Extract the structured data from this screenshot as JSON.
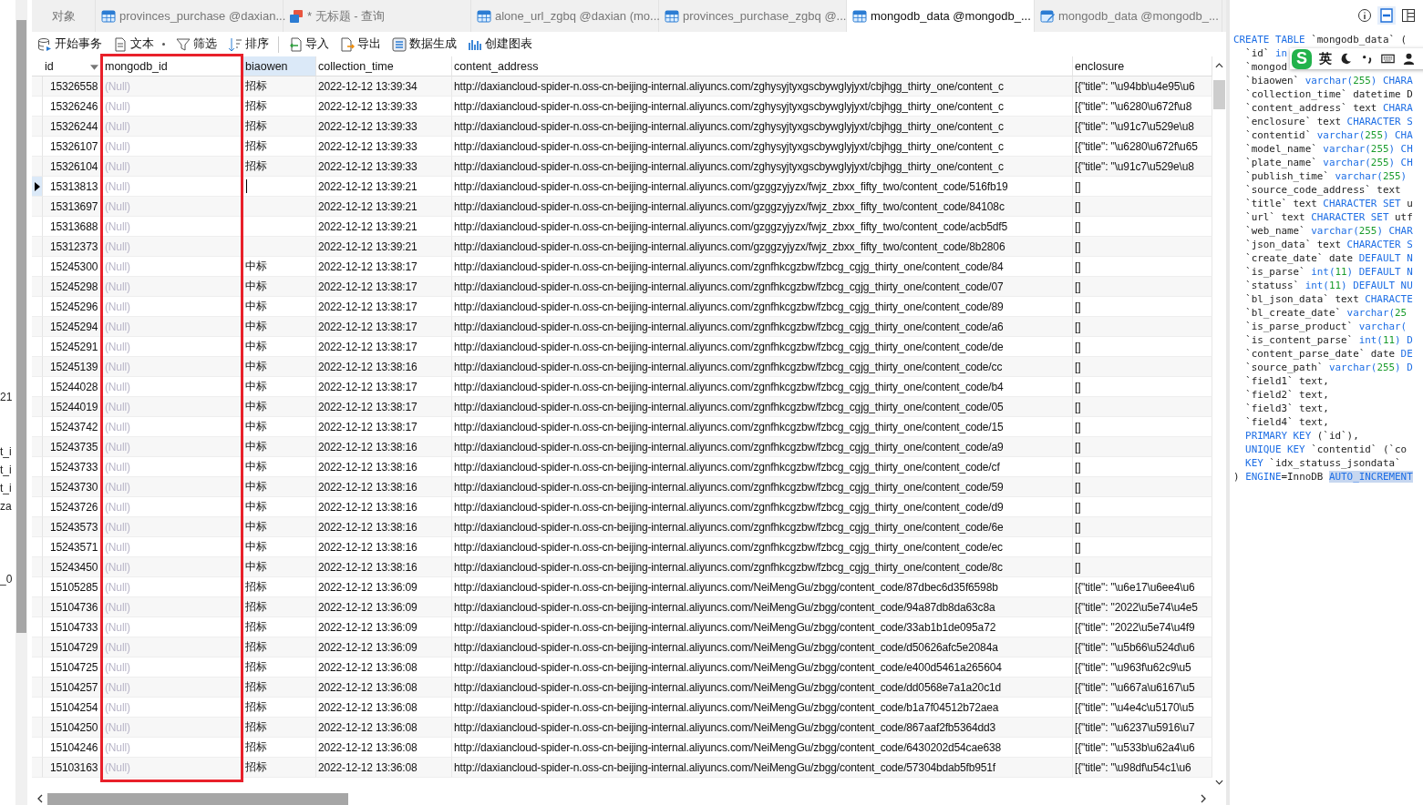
{
  "left_panel": {
    "fragments": [
      "21",
      "t_i",
      "t_i",
      "t_i",
      "za",
      "_0"
    ]
  },
  "tabs": [
    {
      "label": "对象",
      "kind": "plain",
      "selected": false
    },
    {
      "label": "provinces_purchase @daxian...",
      "kind": "table",
      "selected": false
    },
    {
      "label": "* 无标题 - 查询",
      "kind": "query",
      "selected": false
    },
    {
      "label": "alone_url_zgbq @daxian (mo...",
      "kind": "table",
      "selected": false
    },
    {
      "label": "provinces_purchase_zgbq @...",
      "kind": "table",
      "selected": false
    },
    {
      "label": "mongodb_data @mongodb_...",
      "kind": "table",
      "selected": true
    },
    {
      "label": "mongodb_data @mongodb_...",
      "kind": "design",
      "selected": false
    }
  ],
  "toolbar": [
    {
      "label": "开始事务",
      "kind": "transaction"
    },
    {
      "label": "文本",
      "kind": "text"
    },
    {
      "label": "筛选",
      "kind": "filter"
    },
    {
      "label": "排序",
      "kind": "sort"
    },
    {
      "label": "导入",
      "kind": "import"
    },
    {
      "label": "导出",
      "kind": "export"
    },
    {
      "label": "数据生成",
      "kind": "generate"
    },
    {
      "label": "创建图表",
      "kind": "chart"
    }
  ],
  "annotation": {
    "kind": "rectangle"
  },
  "table": {
    "columns": [
      {
        "label": "id",
        "selected": false,
        "menu": true
      },
      {
        "label": "mongodb_id",
        "selected": false,
        "menu": false
      },
      {
        "label": "biaowen",
        "selected": true,
        "menu": false
      },
      {
        "label": "collection_time",
        "selected": false,
        "menu": false
      },
      {
        "label": "content_address",
        "selected": false,
        "menu": false
      },
      {
        "label": "enclosure",
        "selected": false,
        "menu": false
      }
    ],
    "rows": [
      {
        "id": "15326558",
        "mongodb_id": "(Null)",
        "biaowen": "招标",
        "collection_time": "2022-12-12 13:39:34",
        "content_address": "http://daxiancloud-spider-n.oss-cn-beijing-internal.aliyuncs.com/zghysyjtyxgscbywglyjyxt/cbjhgg_thirty_one/content_c",
        "enclosure": "[{\"title\": \"\\u94bb\\u4e95\\u6",
        "selected": false,
        "editing": false
      },
      {
        "id": "15326246",
        "mongodb_id": "(Null)",
        "biaowen": "招标",
        "collection_time": "2022-12-12 13:39:33",
        "content_address": "http://daxiancloud-spider-n.oss-cn-beijing-internal.aliyuncs.com/zghysyjtyxgscbywglyjyxt/cbjhgg_thirty_one/content_c",
        "enclosure": "[{\"title\": \"\\u6280\\u672f\\u8",
        "selected": false,
        "editing": false
      },
      {
        "id": "15326244",
        "mongodb_id": "(Null)",
        "biaowen": "招标",
        "collection_time": "2022-12-12 13:39:33",
        "content_address": "http://daxiancloud-spider-n.oss-cn-beijing-internal.aliyuncs.com/zghysyjtyxgscbywglyjyxt/cbjhgg_thirty_one/content_c",
        "enclosure": "[{\"title\": \"\\u91c7\\u529e\\u8",
        "selected": false,
        "editing": false
      },
      {
        "id": "15326107",
        "mongodb_id": "(Null)",
        "biaowen": "招标",
        "collection_time": "2022-12-12 13:39:33",
        "content_address": "http://daxiancloud-spider-n.oss-cn-beijing-internal.aliyuncs.com/zghysyjtyxgscbywglyjyxt/cbjhgg_thirty_one/content_c",
        "enclosure": "[{\"title\": \"\\u6280\\u672f\\u65",
        "selected": false,
        "editing": false
      },
      {
        "id": "15326104",
        "mongodb_id": "(Null)",
        "biaowen": "招标",
        "collection_time": "2022-12-12 13:39:33",
        "content_address": "http://daxiancloud-spider-n.oss-cn-beijing-internal.aliyuncs.com/zghysyjtyxgscbywglyjyxt/cbjhgg_thirty_one/content_c",
        "enclosure": "[{\"title\": \"\\u91c7\\u529e\\u8",
        "selected": false,
        "editing": false
      },
      {
        "id": "15313813",
        "mongodb_id": "(Null)",
        "collection_time": "2022-12-12 13:39:21",
        "content_address": "http://daxiancloud-spider-n.oss-cn-beijing-internal.aliyuncs.com/gzggzyjyzx/fwjz_zbxx_fifty_two/content_code/516fb19",
        "enclosure": "[]",
        "selected": true,
        "editing": true
      },
      {
        "id": "15313697",
        "mongodb_id": "(Null)",
        "collection_time": "2022-12-12 13:39:21",
        "content_address": "http://daxiancloud-spider-n.oss-cn-beijing-internal.aliyuncs.com/gzggzyjyzx/fwjz_zbxx_fifty_two/content_code/84108c",
        "enclosure": "[]",
        "selected": false,
        "editing": false
      },
      {
        "id": "15313688",
        "mongodb_id": "(Null)",
        "collection_time": "2022-12-12 13:39:21",
        "content_address": "http://daxiancloud-spider-n.oss-cn-beijing-internal.aliyuncs.com/gzggzyjyzx/fwjz_zbxx_fifty_two/content_code/acb5df5",
        "enclosure": "[]",
        "selected": false,
        "editing": false
      },
      {
        "id": "15312373",
        "mongodb_id": "(Null)",
        "collection_time": "2022-12-12 13:39:21",
        "content_address": "http://daxiancloud-spider-n.oss-cn-beijing-internal.aliyuncs.com/gzggzyjyzx/fwjz_zbxx_fifty_two/content_code/8b2806",
        "enclosure": "[]",
        "selected": false,
        "editing": false
      },
      {
        "id": "15245300",
        "mongodb_id": "(Null)",
        "biaowen": "中标",
        "collection_time": "2022-12-12 13:38:17",
        "content_address": "http://daxiancloud-spider-n.oss-cn-beijing-internal.aliyuncs.com/zgnfhkcgzbw/fzbcg_cgjg_thirty_one/content_code/84",
        "enclosure": "[]",
        "selected": false,
        "editing": false
      },
      {
        "id": "15245298",
        "mongodb_id": "(Null)",
        "biaowen": "中标",
        "collection_time": "2022-12-12 13:38:17",
        "content_address": "http://daxiancloud-spider-n.oss-cn-beijing-internal.aliyuncs.com/zgnfhkcgzbw/fzbcg_cgjg_thirty_one/content_code/07",
        "enclosure": "[]",
        "selected": false,
        "editing": false
      },
      {
        "id": "15245296",
        "mongodb_id": "(Null)",
        "biaowen": "中标",
        "collection_time": "2022-12-12 13:38:17",
        "content_address": "http://daxiancloud-spider-n.oss-cn-beijing-internal.aliyuncs.com/zgnfhkcgzbw/fzbcg_cgjg_thirty_one/content_code/89",
        "enclosure": "[]",
        "selected": false,
        "editing": false
      },
      {
        "id": "15245294",
        "mongodb_id": "(Null)",
        "biaowen": "中标",
        "collection_time": "2022-12-12 13:38:17",
        "content_address": "http://daxiancloud-spider-n.oss-cn-beijing-internal.aliyuncs.com/zgnfhkcgzbw/fzbcg_cgjg_thirty_one/content_code/a6",
        "enclosure": "[]",
        "selected": false,
        "editing": false
      },
      {
        "id": "15245291",
        "mongodb_id": "(Null)",
        "biaowen": "中标",
        "collection_time": "2022-12-12 13:38:17",
        "content_address": "http://daxiancloud-spider-n.oss-cn-beijing-internal.aliyuncs.com/zgnfhkcgzbw/fzbcg_cgjg_thirty_one/content_code/de",
        "enclosure": "[]",
        "selected": false,
        "editing": false
      },
      {
        "id": "15245139",
        "mongodb_id": "(Null)",
        "biaowen": "中标",
        "collection_time": "2022-12-12 13:38:16",
        "content_address": "http://daxiancloud-spider-n.oss-cn-beijing-internal.aliyuncs.com/zgnfhkcgzbw/fzbcg_cgjg_thirty_one/content_code/cc",
        "enclosure": "[]",
        "selected": false,
        "editing": false
      },
      {
        "id": "15244028",
        "mongodb_id": "(Null)",
        "biaowen": "中标",
        "collection_time": "2022-12-12 13:38:17",
        "content_address": "http://daxiancloud-spider-n.oss-cn-beijing-internal.aliyuncs.com/zgnfhkcgzbw/fzbcg_cgjg_thirty_one/content_code/b4",
        "enclosure": "[]",
        "selected": false,
        "editing": false
      },
      {
        "id": "15244019",
        "mongodb_id": "(Null)",
        "biaowen": "中标",
        "collection_time": "2022-12-12 13:38:17",
        "content_address": "http://daxiancloud-spider-n.oss-cn-beijing-internal.aliyuncs.com/zgnfhkcgzbw/fzbcg_cgjg_thirty_one/content_code/05",
        "enclosure": "[]",
        "selected": false,
        "editing": false
      },
      {
        "id": "15243742",
        "mongodb_id": "(Null)",
        "biaowen": "中标",
        "collection_time": "2022-12-12 13:38:17",
        "content_address": "http://daxiancloud-spider-n.oss-cn-beijing-internal.aliyuncs.com/zgnfhkcgzbw/fzbcg_cgjg_thirty_one/content_code/15",
        "enclosure": "[]",
        "selected": false,
        "editing": false
      },
      {
        "id": "15243735",
        "mongodb_id": "(Null)",
        "biaowen": "中标",
        "collection_time": "2022-12-12 13:38:16",
        "content_address": "http://daxiancloud-spider-n.oss-cn-beijing-internal.aliyuncs.com/zgnfhkcgzbw/fzbcg_cgjg_thirty_one/content_code/a9",
        "enclosure": "[]",
        "selected": false,
        "editing": false
      },
      {
        "id": "15243733",
        "mongodb_id": "(Null)",
        "biaowen": "中标",
        "collection_time": "2022-12-12 13:38:16",
        "content_address": "http://daxiancloud-spider-n.oss-cn-beijing-internal.aliyuncs.com/zgnfhkcgzbw/fzbcg_cgjg_thirty_one/content_code/cf",
        "enclosure": "[]",
        "selected": false,
        "editing": false
      },
      {
        "id": "15243730",
        "mongodb_id": "(Null)",
        "biaowen": "中标",
        "collection_time": "2022-12-12 13:38:16",
        "content_address": "http://daxiancloud-spider-n.oss-cn-beijing-internal.aliyuncs.com/zgnfhkcgzbw/fzbcg_cgjg_thirty_one/content_code/59",
        "enclosure": "[]",
        "selected": false,
        "editing": false
      },
      {
        "id": "15243726",
        "mongodb_id": "(Null)",
        "biaowen": "中标",
        "collection_time": "2022-12-12 13:38:16",
        "content_address": "http://daxiancloud-spider-n.oss-cn-beijing-internal.aliyuncs.com/zgnfhkcgzbw/fzbcg_cgjg_thirty_one/content_code/d9",
        "enclosure": "[]",
        "selected": false,
        "editing": false
      },
      {
        "id": "15243573",
        "mongodb_id": "(Null)",
        "biaowen": "中标",
        "collection_time": "2022-12-12 13:38:16",
        "content_address": "http://daxiancloud-spider-n.oss-cn-beijing-internal.aliyuncs.com/zgnfhkcgzbw/fzbcg_cgjg_thirty_one/content_code/6e",
        "enclosure": "[]",
        "selected": false,
        "editing": false
      },
      {
        "id": "15243571",
        "mongodb_id": "(Null)",
        "biaowen": "中标",
        "collection_time": "2022-12-12 13:38:16",
        "content_address": "http://daxiancloud-spider-n.oss-cn-beijing-internal.aliyuncs.com/zgnfhkcgzbw/fzbcg_cgjg_thirty_one/content_code/ec",
        "enclosure": "[]",
        "selected": false,
        "editing": false
      },
      {
        "id": "15243450",
        "mongodb_id": "(Null)",
        "biaowen": "中标",
        "collection_time": "2022-12-12 13:38:16",
        "content_address": "http://daxiancloud-spider-n.oss-cn-beijing-internal.aliyuncs.com/zgnfhkcgzbw/fzbcg_cgjg_thirty_one/content_code/8c",
        "enclosure": "[]",
        "selected": false,
        "editing": false
      },
      {
        "id": "15105285",
        "mongodb_id": "(Null)",
        "biaowen": "招标",
        "collection_time": "2022-12-12 13:36:09",
        "content_address": "http://daxiancloud-spider-n.oss-cn-beijing-internal.aliyuncs.com/NeiMengGu/zbgg/content_code/87dbec6d35f6598b",
        "enclosure": "[{\"title\": \"\\u6e17\\u6ee4\\u6",
        "selected": false,
        "editing": false
      },
      {
        "id": "15104736",
        "mongodb_id": "(Null)",
        "biaowen": "招标",
        "collection_time": "2022-12-12 13:36:09",
        "content_address": "http://daxiancloud-spider-n.oss-cn-beijing-internal.aliyuncs.com/NeiMengGu/zbgg/content_code/94a87db8da63c8a",
        "enclosure": "[{\"title\": \"2022\\u5e74\\u4e5",
        "selected": false,
        "editing": false
      },
      {
        "id": "15104733",
        "mongodb_id": "(Null)",
        "biaowen": "招标",
        "collection_time": "2022-12-12 13:36:09",
        "content_address": "http://daxiancloud-spider-n.oss-cn-beijing-internal.aliyuncs.com/NeiMengGu/zbgg/content_code/33ab1b1de095a72",
        "enclosure": "[{\"title\": \"2022\\u5e74\\u4f9",
        "selected": false,
        "editing": false
      },
      {
        "id": "15104729",
        "mongodb_id": "(Null)",
        "biaowen": "招标",
        "collection_time": "2022-12-12 13:36:09",
        "content_address": "http://daxiancloud-spider-n.oss-cn-beijing-internal.aliyuncs.com/NeiMengGu/zbgg/content_code/d50626afc5e2084a",
        "enclosure": "[{\"title\": \"\\u5b66\\u524d\\u6",
        "selected": false,
        "editing": false
      },
      {
        "id": "15104725",
        "mongodb_id": "(Null)",
        "biaowen": "招标",
        "collection_time": "2022-12-12 13:36:08",
        "content_address": "http://daxiancloud-spider-n.oss-cn-beijing-internal.aliyuncs.com/NeiMengGu/zbgg/content_code/e400d5461a265604",
        "enclosure": "[{\"title\": \"\\u963f\\u62c9\\u5",
        "selected": false,
        "editing": false
      },
      {
        "id": "15104257",
        "mongodb_id": "(Null)",
        "biaowen": "招标",
        "collection_time": "2022-12-12 13:36:08",
        "content_address": "http://daxiancloud-spider-n.oss-cn-beijing-internal.aliyuncs.com/NeiMengGu/zbgg/content_code/dd0568e7a1a20c1d",
        "enclosure": "[{\"title\": \"\\u667a\\u6167\\u5",
        "selected": false,
        "editing": false
      },
      {
        "id": "15104254",
        "mongodb_id": "(Null)",
        "biaowen": "招标",
        "collection_time": "2022-12-12 13:36:08",
        "content_address": "http://daxiancloud-spider-n.oss-cn-beijing-internal.aliyuncs.com/NeiMengGu/zbgg/content_code/b1a7f04512b72aea",
        "enclosure": "[{\"title\": \"\\u4e4c\\u5170\\u5",
        "selected": false,
        "editing": false
      },
      {
        "id": "15104250",
        "mongodb_id": "(Null)",
        "biaowen": "招标",
        "collection_time": "2022-12-12 13:36:08",
        "content_address": "http://daxiancloud-spider-n.oss-cn-beijing-internal.aliyuncs.com/NeiMengGu/zbgg/content_code/867aaf2fb5364dd3",
        "enclosure": "[{\"title\": \"\\u6237\\u5916\\u7",
        "selected": false,
        "editing": false
      },
      {
        "id": "15104246",
        "mongodb_id": "(Null)",
        "biaowen": "招标",
        "collection_time": "2022-12-12 13:36:08",
        "content_address": "http://daxiancloud-spider-n.oss-cn-beijing-internal.aliyuncs.com/NeiMengGu/zbgg/content_code/6430202d54cae638",
        "enclosure": "[{\"title\": \"\\u533b\\u62a4\\u6",
        "selected": false,
        "editing": false
      },
      {
        "id": "15103163",
        "mongodb_id": "(Null)",
        "biaowen": "招标",
        "collection_time": "2022-12-12 13:36:08",
        "content_address": "http://daxiancloud-spider-n.oss-cn-beijing-internal.aliyuncs.com/NeiMengGu/zbgg/content_code/57304bdab5fb951f",
        "enclosure": "[{\"title\": \"\\u98df\\u54c1\\u6",
        "selected": false,
        "editing": false
      }
    ]
  },
  "side_panel": {
    "views": [
      {
        "kind": "info",
        "selected": false
      },
      {
        "kind": "ddl",
        "selected": true
      },
      {
        "kind": "form",
        "selected": false
      }
    ],
    "ime_toolbar": {
      "logo": "S",
      "mode": "英"
    },
    "ddl": [
      [
        {
          "text": "CREATE TABLE",
          "kind": "keyword"
        },
        {
          "text": " `mongodb_data` (",
          "kind": "plain"
        }
      ],
      [
        {
          "text": "  `id` ",
          "kind": "plain"
        },
        {
          "text": "in",
          "kind": "keyword"
        }
      ],
      [
        {
          "text": "  `mongod",
          "kind": "plain"
        }
      ],
      [
        {
          "text": "  `biaowen` ",
          "kind": "plain"
        },
        {
          "text": "varchar(",
          "kind": "keyword"
        },
        {
          "text": "255",
          "kind": "number"
        },
        {
          "text": ") CHARA",
          "kind": "keyword"
        }
      ],
      [
        {
          "text": "  `collection_time` datetime D",
          "kind": "plain"
        }
      ],
      [
        {
          "text": "  `content_address` text ",
          "kind": "plain"
        },
        {
          "text": "CHARA",
          "kind": "keyword"
        }
      ],
      [
        {
          "text": "  `enclosure` text ",
          "kind": "plain"
        },
        {
          "text": "CHARACTER S",
          "kind": "keyword"
        }
      ],
      [
        {
          "text": "  `contentid` ",
          "kind": "plain"
        },
        {
          "text": "varchar(",
          "kind": "keyword"
        },
        {
          "text": "255",
          "kind": "number"
        },
        {
          "text": ") CHA",
          "kind": "keyword"
        }
      ],
      [
        {
          "text": "  `model_name` ",
          "kind": "plain"
        },
        {
          "text": "varchar(",
          "kind": "keyword"
        },
        {
          "text": "255",
          "kind": "number"
        },
        {
          "text": ") CH",
          "kind": "keyword"
        }
      ],
      [
        {
          "text": "  `plate_name` ",
          "kind": "plain"
        },
        {
          "text": "varchar(",
          "kind": "keyword"
        },
        {
          "text": "255",
          "kind": "number"
        },
        {
          "text": ") CH",
          "kind": "keyword"
        }
      ],
      [
        {
          "text": "  `publish_time` ",
          "kind": "plain"
        },
        {
          "text": "varchar(",
          "kind": "keyword"
        },
        {
          "text": "255",
          "kind": "number"
        },
        {
          "text": ")",
          "kind": "keyword"
        }
      ],
      [
        {
          "text": "  `source_code_address` text",
          "kind": "plain"
        }
      ],
      [
        {
          "text": "  `title` text ",
          "kind": "plain"
        },
        {
          "text": "CHARACTER SET",
          "kind": "keyword"
        },
        {
          "text": " u",
          "kind": "plain"
        }
      ],
      [
        {
          "text": "  `url` text ",
          "kind": "plain"
        },
        {
          "text": "CHARACTER SET",
          "kind": "keyword"
        },
        {
          "text": " utf",
          "kind": "plain"
        }
      ],
      [
        {
          "text": "  `web_name` ",
          "kind": "plain"
        },
        {
          "text": "varchar(",
          "kind": "keyword"
        },
        {
          "text": "255",
          "kind": "number"
        },
        {
          "text": ") CHAR",
          "kind": "keyword"
        }
      ],
      [
        {
          "text": "  `json_data` text ",
          "kind": "plain"
        },
        {
          "text": "CHARACTER S",
          "kind": "keyword"
        }
      ],
      [
        {
          "text": "  `create_date` date ",
          "kind": "plain"
        },
        {
          "text": "DEFAULT N",
          "kind": "keyword"
        }
      ],
      [
        {
          "text": "  `is_parse` ",
          "kind": "plain"
        },
        {
          "text": "int(",
          "kind": "keyword"
        },
        {
          "text": "11",
          "kind": "number"
        },
        {
          "text": ") DEFAULT N",
          "kind": "keyword"
        }
      ],
      [
        {
          "text": "  `statuss` ",
          "kind": "plain"
        },
        {
          "text": "int(",
          "kind": "keyword"
        },
        {
          "text": "11",
          "kind": "number"
        },
        {
          "text": ") DEFAULT NU",
          "kind": "keyword"
        }
      ],
      [
        {
          "text": "  `bl_json_data` text ",
          "kind": "plain"
        },
        {
          "text": "CHARACTE",
          "kind": "keyword"
        }
      ],
      [
        {
          "text": "  `bl_create_date` ",
          "kind": "plain"
        },
        {
          "text": "varchar(",
          "kind": "keyword"
        },
        {
          "text": "25",
          "kind": "number"
        }
      ],
      [
        {
          "text": "  `is_parse_product` ",
          "kind": "plain"
        },
        {
          "text": "varchar(",
          "kind": "keyword"
        }
      ],
      [
        {
          "text": "  `is_content_parse` ",
          "kind": "plain"
        },
        {
          "text": "int(",
          "kind": "keyword"
        },
        {
          "text": "11",
          "kind": "number"
        },
        {
          "text": ") D",
          "kind": "keyword"
        }
      ],
      [
        {
          "text": "  `content_parse_date` date ",
          "kind": "plain"
        },
        {
          "text": "DE",
          "kind": "keyword"
        }
      ],
      [
        {
          "text": "  `source_path` ",
          "kind": "plain"
        },
        {
          "text": "varchar(",
          "kind": "keyword"
        },
        {
          "text": "255",
          "kind": "number"
        },
        {
          "text": ") D",
          "kind": "keyword"
        }
      ],
      [
        {
          "text": "  `field1` text,",
          "kind": "plain"
        }
      ],
      [
        {
          "text": "  `field2` text,",
          "kind": "plain"
        }
      ],
      [
        {
          "text": "  `field3` text,",
          "kind": "plain"
        }
      ],
      [
        {
          "text": "  `field4` text,",
          "kind": "plain"
        }
      ],
      [
        {
          "text": "  PRIMARY KEY",
          "kind": "keyword"
        },
        {
          "text": " (`id`),",
          "kind": "plain"
        }
      ],
      [
        {
          "text": "  UNIQUE KEY",
          "kind": "keyword"
        },
        {
          "text": " `contentid` (`co",
          "kind": "plain"
        }
      ],
      [
        {
          "text": "  KEY",
          "kind": "keyword"
        },
        {
          "text": " `idx_statuss_jsondata`",
          "kind": "plain"
        }
      ],
      [
        {
          "text": ") ",
          "kind": "plain"
        },
        {
          "text": "ENGINE",
          "kind": "keyword"
        },
        {
          "text": "=InnoDB ",
          "kind": "plain"
        },
        {
          "text": "AUTO_INCREMENT",
          "kind": "selection"
        }
      ]
    ]
  }
}
